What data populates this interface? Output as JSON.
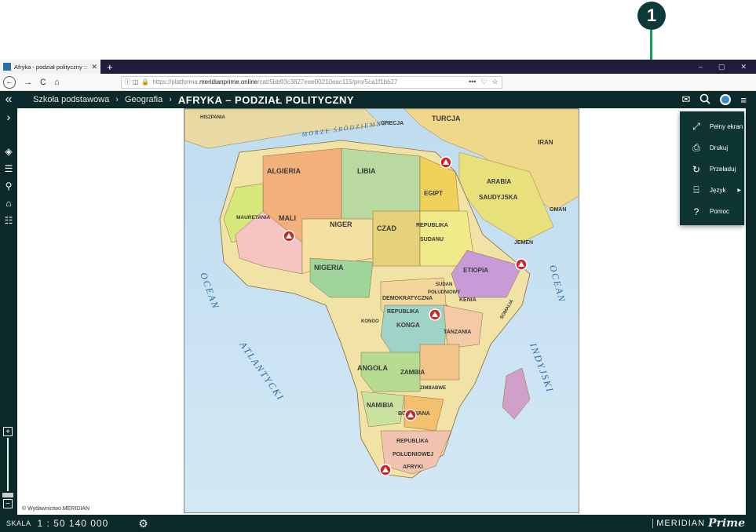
{
  "callout": {
    "number": "1"
  },
  "browser": {
    "tab_title": "Afryka - podział polityczny :: M",
    "tab_close": "✕",
    "new_tab": "+",
    "window_controls": [
      "–",
      "▢",
      "✕"
    ],
    "nav": {
      "back": "←",
      "forward": "→",
      "reload": "C",
      "home": "⌂"
    },
    "url_prefix": "https://platforma.",
    "url_domain": "meridianprime.online",
    "url_path": "/cat/5bb93c3827eee00210eac115/pro/5ca1f1bb27",
    "url_icons": [
      "•••",
      "♡",
      "☆"
    ]
  },
  "app": {
    "collapse_icon": "«",
    "breadcrumb": {
      "items": [
        "Szkoła podstawowa",
        "Geografia"
      ],
      "separator": "›",
      "current": "AFRYKA – PODZIAŁ POLITYCZNY"
    },
    "header_icons": [
      "mail-icon",
      "search-icon",
      "user-icon",
      "menu-icon"
    ],
    "sidebar_icons": [
      "expand-icon",
      "layers-icon",
      "list-icon",
      "location-icon",
      "education-icon",
      "stack-icon"
    ],
    "zoom": {
      "plus": "+",
      "minus": "−"
    },
    "copyright": "© Wydawnictwo MERIDIAN",
    "status": {
      "scale_label": "SKALA",
      "scale_value": "1 : 50 140 000"
    },
    "brand": {
      "name": "MERIDIAN",
      "prime": "Prime"
    }
  },
  "menu": {
    "items": [
      {
        "label": "Pełny ekran",
        "icon": "fullscreen-icon"
      },
      {
        "label": "Drukuj",
        "icon": "print-icon"
      },
      {
        "label": "Przeładuj",
        "icon": "reload-icon"
      },
      {
        "label": "Język",
        "icon": "language-icon"
      },
      {
        "label": "Pomoc",
        "icon": "help-icon"
      }
    ]
  },
  "map": {
    "countries": {
      "algieria": "ALGIERIA",
      "libia": "LIBIA",
      "egipt": "EGIPT",
      "mali": "MALI",
      "niger": "NIGER",
      "czad": "CZAD",
      "mauretania": "MAURETANIA",
      "nigeria": "NIGERIA",
      "sudan": "REPUBLIKA",
      "sudan2": "SUDANU",
      "arabia": "ARABIA",
      "saudyjska": "SAUDYJSKA",
      "etiopia": "ETIOPIA",
      "kenia": "KENIA",
      "tanzania": "TANZANIA",
      "kongo_dem": "DEMOKRATYCZNA",
      "republika": "REPUBLIKA",
      "konga": "KONGA",
      "angola": "ANGOLA",
      "zambia": "ZAMBIA",
      "namibia": "NAMIBIA",
      "botswana": "BOTSWANA",
      "rpa1": "REPUBLIKA",
      "rpa2": "POŁUDNIOWEJ",
      "rpa3": "AFRYKI",
      "turcja": "TURCJA",
      "iran": "IRAN",
      "grecja": "GRECJA",
      "hiszpania": "HISZPANIA",
      "jemen": "JEMEN",
      "oman": "OMAN",
      "sudan_pd1": "SUDAN",
      "sudan_pd2": "POŁUDNIOWY",
      "somalia": "SOMALIA",
      "kongo": "KONGO",
      "zimbabwe": "ZIMBABWE"
    },
    "oceans": {
      "atl1": "OCEAN",
      "atl2": "ATLANTYCKI",
      "ind1": "OCEAN",
      "ind2": "INDYJSKI",
      "morze": "MORZE ŚRÓDZIEMNE"
    }
  }
}
